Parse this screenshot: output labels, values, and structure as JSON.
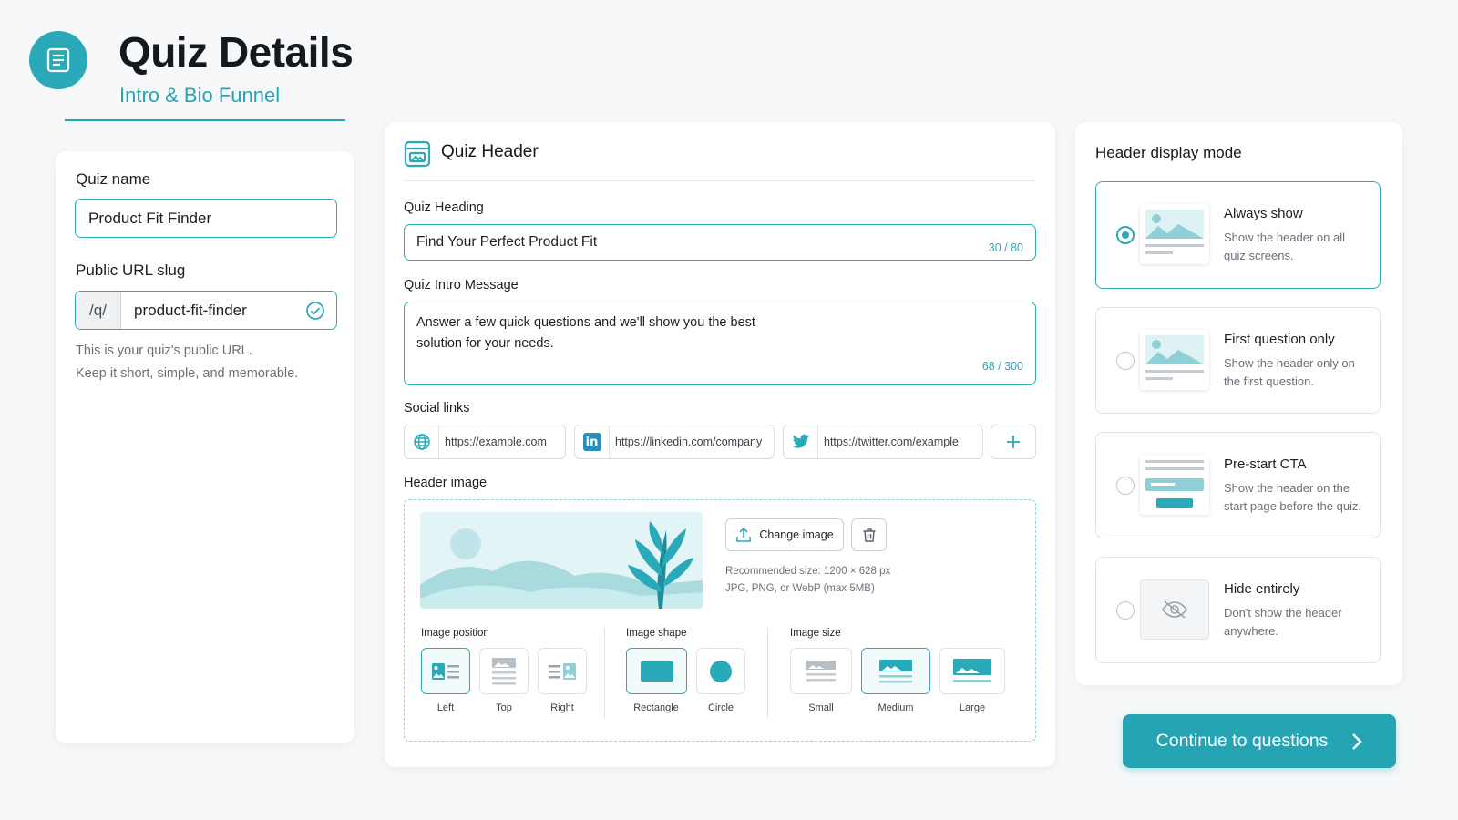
{
  "header": {
    "title": "Quiz Details",
    "subtitle": "Intro & Bio Funnel",
    "icon": "quiz-document-icon"
  },
  "left": {
    "quiz_name_label": "Quiz name",
    "quiz_name_value": "Product Fit Finder",
    "slug_label": "Public URL slug",
    "slug_prefix": "/q/",
    "slug_value": "product-fit-finder",
    "helper_line1": "This is your quiz's public URL.",
    "helper_line2": "Keep it short, simple, and memorable."
  },
  "quiz_header": {
    "title": "Quiz Header",
    "heading_label": "Quiz Heading",
    "heading_value": "Find Your Perfect Product Fit",
    "heading_count": "30 / 80",
    "intro_label": "Quiz Intro Message",
    "intro_line1": "Answer a few quick questions and we'll show you the best",
    "intro_line2": "solution for your needs.",
    "intro_count": "68 / 300",
    "social_label": "Social links",
    "social_links": [
      {
        "icon": "globe-icon",
        "placeholder": "https://example.com"
      },
      {
        "icon": "linkedin-icon",
        "placeholder": "https://linkedin.com/company"
      },
      {
        "icon": "twitter-icon",
        "placeholder": "https://twitter.com/example"
      }
    ],
    "header_image_label": "Header image",
    "change_image_label": "Change image",
    "recommended_line1": "Recommended size: 1200 × 628 px",
    "recommended_line2": "JPG, PNG, or WebP (max 5MB)",
    "position_label": "Image position",
    "positions": [
      "Left",
      "Top",
      "Right"
    ],
    "position_selected": "Left",
    "shape_label": "Image shape",
    "shapes": [
      "Rectangle",
      "Circle"
    ],
    "shape_selected": "Rectangle",
    "size_label": "Image size",
    "sizes": [
      "Small",
      "Medium",
      "Large"
    ],
    "size_selected": "Medium"
  },
  "display_mode": {
    "title": "Header display mode",
    "selected": "Always show",
    "modes": [
      {
        "title": "Always show",
        "desc1": "Show the header on all",
        "desc2": "quiz screens."
      },
      {
        "title": "First question only",
        "desc1": "Show the header only on",
        "desc2": "the first question."
      },
      {
        "title": "Pre-start CTA",
        "desc1": "Show the header on the",
        "desc2": "start page before the quiz."
      },
      {
        "title": "Hide entirely",
        "desc1": "Don't show the header",
        "desc2": "anywhere."
      }
    ]
  },
  "cta_label": "Continue to questions",
  "colors": {
    "accent": "#25a5b4",
    "accent_light": "#f1fbfc",
    "border": "#dfe3e6"
  }
}
